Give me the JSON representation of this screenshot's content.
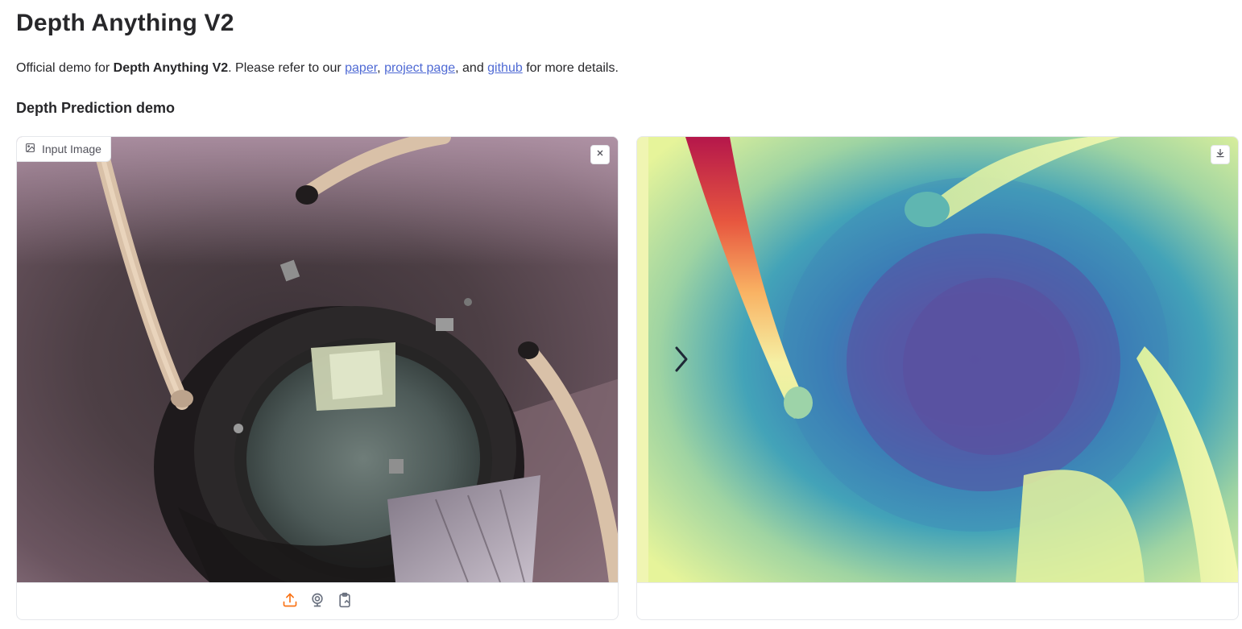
{
  "page": {
    "title": "Depth Anything V2",
    "description": {
      "prefix": "Official demo for ",
      "bold": "Depth Anything V2",
      "middle": ". Please refer to our ",
      "link_paper": "paper",
      "sep1": ", ",
      "link_project": "project page",
      "sep2": ", and ",
      "link_github": "github",
      "suffix": " for more details."
    },
    "section_title": "Depth Prediction demo"
  },
  "input_panel": {
    "label": "Input Image",
    "label_icon": "image-icon",
    "clear_icon": "close-icon",
    "toolbar_icons": [
      "upload-icon",
      "webcam-icon",
      "clipboard-icon"
    ]
  },
  "output_panel": {
    "download_icon": "download-icon",
    "slider_icon": "chevron-right-icon"
  },
  "colors": {
    "accent": "#f97316",
    "link": "#4f6ad4",
    "text": "#27272a",
    "border": "#e5e7eb"
  }
}
